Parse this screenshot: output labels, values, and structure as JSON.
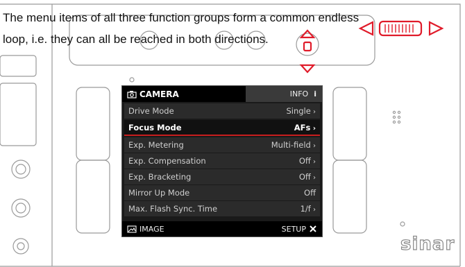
{
  "caption": {
    "line1": "The menu items of all three function groups form a common endless",
    "line2": "loop, i.e. they can all be reached in both directions."
  },
  "screen": {
    "header": {
      "title": "CAMERA",
      "info_label": "INFO",
      "info_glyph": "i"
    },
    "rows": [
      {
        "label": "Drive Mode",
        "value": "Single"
      },
      {
        "label": "Focus Mode",
        "value": "AFs"
      },
      {
        "label": "Exp. Metering",
        "value": "Multi-field"
      },
      {
        "label": "Exp. Compensation",
        "value": "Off"
      },
      {
        "label": "Exp. Bracketing",
        "value": "Off"
      },
      {
        "label": "Mirror Up Mode",
        "value": "Off"
      },
      {
        "label": "Max. Flash Sync. Time",
        "value": "1/f"
      }
    ],
    "selected_index": 1,
    "footer": {
      "left_label": "IMAGE",
      "right_label": "SETUP"
    }
  },
  "brand": {
    "logo": "sinar"
  },
  "colors": {
    "highlight": "#c81e1e",
    "arrows": "#e01b2a"
  },
  "icons": [
    "camera-icon",
    "info-icon",
    "image-icon",
    "setup-icon",
    "navigation-arrows-icon",
    "thumbwheel-arrows-icon"
  ]
}
